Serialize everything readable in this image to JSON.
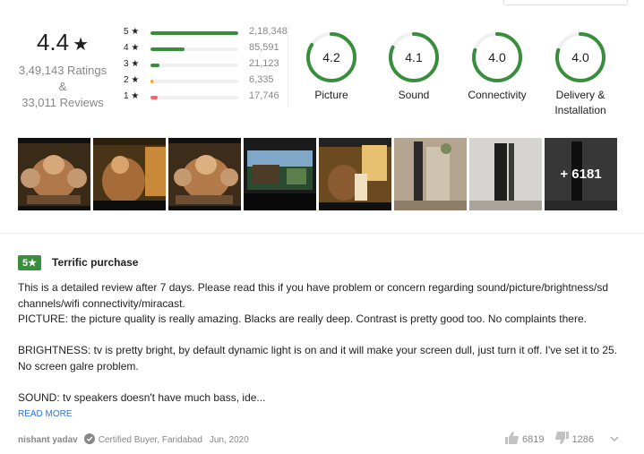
{
  "summary": {
    "average": "4.4",
    "star_glyph": "★",
    "ratings_text": "3,49,143 Ratings",
    "ampersand": "&",
    "reviews_text": "33,011 Reviews"
  },
  "distribution": [
    {
      "label": "5 ★",
      "count": "2,18,348",
      "fraction": 1.0,
      "color": "#388e3c"
    },
    {
      "label": "4 ★",
      "count": "85,591",
      "fraction": 0.39,
      "color": "#388e3c"
    },
    {
      "label": "3 ★",
      "count": "21,123",
      "fraction": 0.1,
      "color": "#388e3c"
    },
    {
      "label": "2 ★",
      "count": "6,335",
      "fraction": 0.03,
      "color": "#ff9f00"
    },
    {
      "label": "1 ★",
      "count": "17,746",
      "fraction": 0.08,
      "color": "#ff6161"
    }
  ],
  "aspects": [
    {
      "value": "4.2",
      "label": "Picture",
      "fraction": 0.84
    },
    {
      "value": "4.1",
      "label": "Sound",
      "fraction": 0.82
    },
    {
      "value": "4.0",
      "label": "Connectivity",
      "fraction": 0.8
    },
    {
      "value": "4.0",
      "label": "Delivery & Installation",
      "fraction": 0.8
    }
  ],
  "gauge_color": "#388e3c",
  "gallery": {
    "more_text": "+ 6181"
  },
  "review": {
    "rating_badge": "5★",
    "badge_color": "#388e3c",
    "title": "Terrific purchase",
    "body": "This is a detailed review after 7 days. Please read this if you have problem or concern regarding sound/picture/brightness/sd channels/wifi connectivity/miracast.\nPICTURE: the picture quality is really amazing. Blacks are really deep. Contrast is pretty good too. No complaints there.\n\nBRIGHTNESS: tv is pretty bright, by default dynamic light is on and it will make your screen dull, just turn it off. I've set it to 25. No screen galre problem.\n\nSOUND: tv speakers doesn't have much bass, ide...",
    "read_more": "READ MORE",
    "author": "nishant yadav",
    "certified": "Certified Buyer, Faridabad",
    "date": "Jun, 2020",
    "likes": "6819",
    "dislikes": "1286"
  }
}
